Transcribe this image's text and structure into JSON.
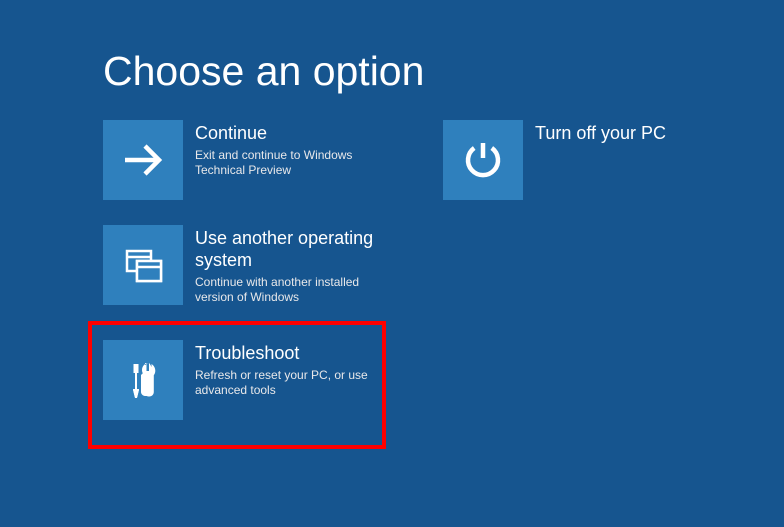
{
  "title": "Choose an option",
  "tiles": [
    {
      "title": "Continue",
      "desc": "Exit and continue to Windows Technical Preview"
    },
    {
      "title": "Turn off your PC",
      "desc": ""
    },
    {
      "title": "Use another operating system",
      "desc": "Continue with another installed version of Windows"
    },
    {
      "title": "Troubleshoot",
      "desc": "Refresh or reset your PC, or use advanced tools"
    }
  ]
}
